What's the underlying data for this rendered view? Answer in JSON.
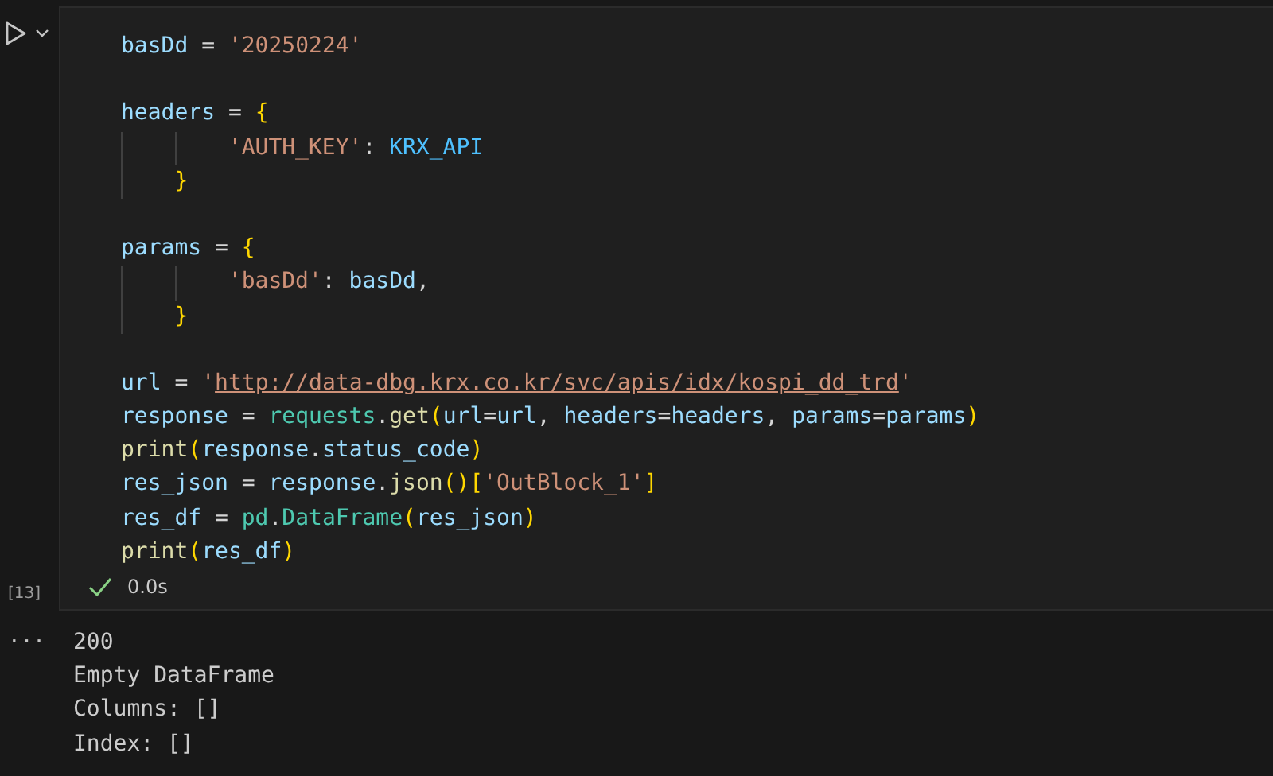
{
  "cell": {
    "execution_count": "[13]",
    "code_lines": [
      {
        "kind": "code",
        "tokens": [
          {
            "kind": "var",
            "text": "basDd"
          },
          {
            "kind": "op",
            "text": " = "
          },
          {
            "kind": "str",
            "text": "'20250224'"
          }
        ]
      },
      {
        "kind": "blank"
      },
      {
        "kind": "code",
        "tokens": [
          {
            "kind": "var",
            "text": "headers"
          },
          {
            "kind": "op",
            "text": " = "
          },
          {
            "kind": "brace",
            "text": "{"
          }
        ]
      },
      {
        "kind": "code",
        "tokens": [
          {
            "kind": "indent"
          },
          {
            "kind": "indent"
          },
          {
            "kind": "str",
            "text": "'AUTH_KEY'"
          },
          {
            "kind": "op",
            "text": ": "
          },
          {
            "kind": "const",
            "text": "KRX_API"
          }
        ]
      },
      {
        "kind": "code",
        "tokens": [
          {
            "kind": "indent"
          },
          {
            "kind": "brace",
            "text": "}"
          }
        ]
      },
      {
        "kind": "blank"
      },
      {
        "kind": "code",
        "tokens": [
          {
            "kind": "var",
            "text": "params"
          },
          {
            "kind": "op",
            "text": " = "
          },
          {
            "kind": "brace",
            "text": "{"
          }
        ]
      },
      {
        "kind": "code",
        "tokens": [
          {
            "kind": "indent"
          },
          {
            "kind": "indent"
          },
          {
            "kind": "str",
            "text": "'basDd'"
          },
          {
            "kind": "op",
            "text": ": "
          },
          {
            "kind": "var",
            "text": "basDd"
          },
          {
            "kind": "op",
            "text": ","
          }
        ]
      },
      {
        "kind": "code",
        "tokens": [
          {
            "kind": "indent"
          },
          {
            "kind": "brace",
            "text": "}"
          }
        ]
      },
      {
        "kind": "blank"
      },
      {
        "kind": "code",
        "tokens": [
          {
            "kind": "var",
            "text": "url"
          },
          {
            "kind": "op",
            "text": " = "
          },
          {
            "kind": "str",
            "text": "'"
          },
          {
            "kind": "link",
            "text": "http://data-dbg.krx.co.kr/svc/apis/idx/kospi_dd_trd"
          },
          {
            "kind": "str",
            "text": "'"
          }
        ]
      },
      {
        "kind": "code",
        "tokens": [
          {
            "kind": "var",
            "text": "response"
          },
          {
            "kind": "op",
            "text": " = "
          },
          {
            "kind": "cls",
            "text": "requests"
          },
          {
            "kind": "op",
            "text": "."
          },
          {
            "kind": "func",
            "text": "get"
          },
          {
            "kind": "brace",
            "text": "("
          },
          {
            "kind": "var",
            "text": "url"
          },
          {
            "kind": "op",
            "text": "="
          },
          {
            "kind": "var",
            "text": "url"
          },
          {
            "kind": "op",
            "text": ", "
          },
          {
            "kind": "var",
            "text": "headers"
          },
          {
            "kind": "op",
            "text": "="
          },
          {
            "kind": "var",
            "text": "headers"
          },
          {
            "kind": "op",
            "text": ", "
          },
          {
            "kind": "var",
            "text": "params"
          },
          {
            "kind": "op",
            "text": "="
          },
          {
            "kind": "var",
            "text": "params"
          },
          {
            "kind": "brace",
            "text": ")"
          }
        ]
      },
      {
        "kind": "code",
        "tokens": [
          {
            "kind": "func",
            "text": "print"
          },
          {
            "kind": "brace",
            "text": "("
          },
          {
            "kind": "var",
            "text": "response"
          },
          {
            "kind": "op",
            "text": "."
          },
          {
            "kind": "var",
            "text": "status_code"
          },
          {
            "kind": "brace",
            "text": ")"
          }
        ]
      },
      {
        "kind": "code",
        "tokens": [
          {
            "kind": "var",
            "text": "res_json"
          },
          {
            "kind": "op",
            "text": " = "
          },
          {
            "kind": "var",
            "text": "response"
          },
          {
            "kind": "op",
            "text": "."
          },
          {
            "kind": "func",
            "text": "json"
          },
          {
            "kind": "brace",
            "text": "()["
          },
          {
            "kind": "str",
            "text": "'OutBlock_1'"
          },
          {
            "kind": "brace",
            "text": "]"
          }
        ]
      },
      {
        "kind": "code",
        "tokens": [
          {
            "kind": "var",
            "text": "res_df"
          },
          {
            "kind": "op",
            "text": " = "
          },
          {
            "kind": "cls",
            "text": "pd"
          },
          {
            "kind": "op",
            "text": "."
          },
          {
            "kind": "cls",
            "text": "DataFrame"
          },
          {
            "kind": "brace",
            "text": "("
          },
          {
            "kind": "var",
            "text": "res_json"
          },
          {
            "kind": "brace",
            "text": ")"
          }
        ]
      },
      {
        "kind": "code",
        "tokens": [
          {
            "kind": "func",
            "text": "print"
          },
          {
            "kind": "brace",
            "text": "("
          },
          {
            "kind": "var",
            "text": "res_df"
          },
          {
            "kind": "brace",
            "text": ")"
          }
        ]
      }
    ],
    "status": {
      "succeeded": true,
      "duration": "0.0s"
    },
    "output": {
      "more": "...",
      "lines": [
        "200",
        "Empty DataFrame",
        "Columns: []",
        "Index: []"
      ]
    }
  }
}
